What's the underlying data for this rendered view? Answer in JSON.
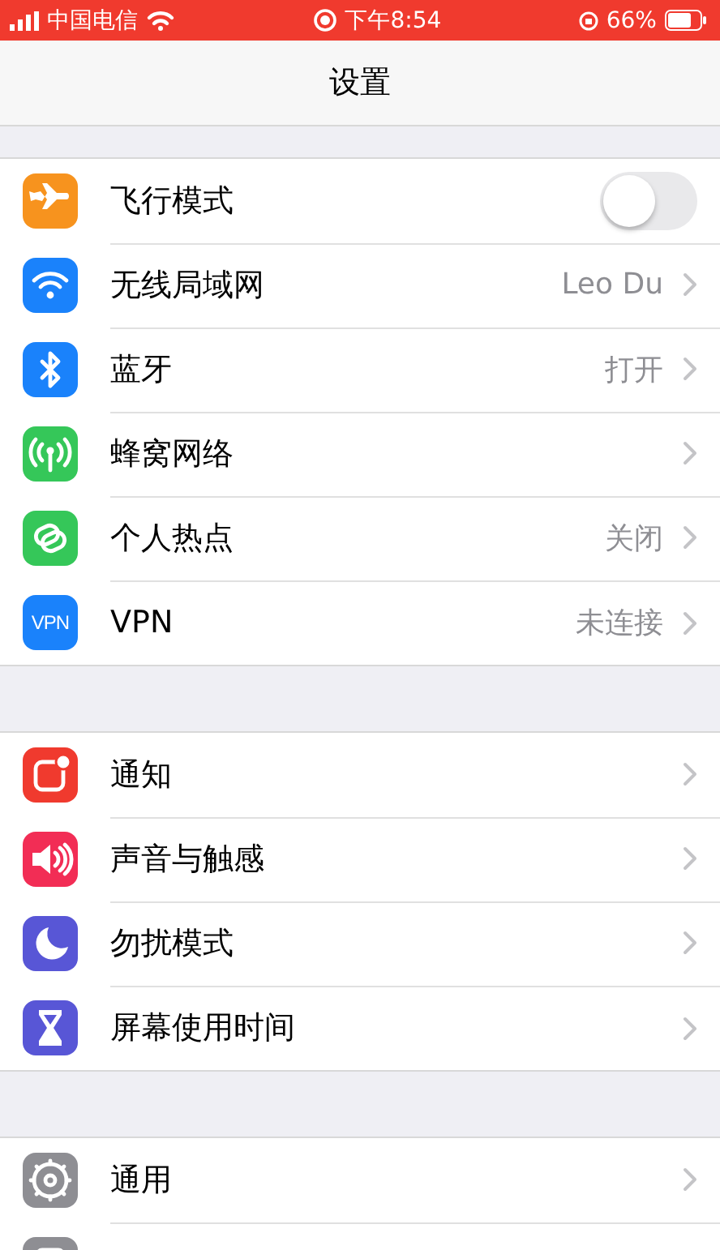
{
  "status_bar": {
    "carrier": "中国电信",
    "time": "下午8:54",
    "battery": "66%"
  },
  "title": "设置",
  "sections": [
    {
      "items": [
        {
          "kind": "toggle",
          "color": "#f7931e",
          "label": "飞行模式",
          "on": false
        },
        {
          "kind": "link",
          "color": "#1a82fb",
          "label": "无线局域网",
          "value": "Leo Du"
        },
        {
          "kind": "link",
          "color": "#1a82fb",
          "label": "蓝牙",
          "value": "打开"
        },
        {
          "kind": "link",
          "color": "#35c759",
          "label": "蜂窝网络"
        },
        {
          "kind": "link",
          "color": "#35c759",
          "label": "个人热点",
          "value": "关闭"
        },
        {
          "kind": "link",
          "icon_text": "VPN",
          "color": "#1a82fb",
          "label": "VPN",
          "value": "未连接"
        }
      ]
    },
    {
      "items": [
        {
          "kind": "link",
          "color": "#f03a2e",
          "label": "通知"
        },
        {
          "kind": "link",
          "color": "#f22d55",
          "label": "声音与触感"
        },
        {
          "kind": "link",
          "color": "#5856d6",
          "label": "勿扰模式"
        },
        {
          "kind": "link",
          "color": "#5856d6",
          "label": "屏幕使用时间"
        }
      ]
    },
    {
      "items": [
        {
          "kind": "link",
          "color": "#8e8e93",
          "label": "通用"
        },
        {
          "kind": "cut",
          "color": "#8e8e93"
        }
      ]
    }
  ]
}
